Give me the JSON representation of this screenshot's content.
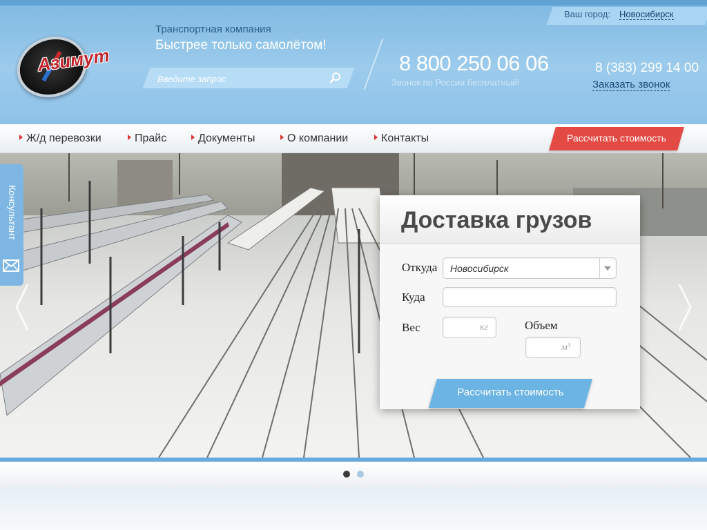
{
  "header": {
    "city_label": "Ваш город:",
    "city_value": "Новосибирск",
    "logo_text": "Азимут",
    "tagline_small": "Транспортная компания",
    "tagline_big": "Быстрее только самолётом!",
    "search_placeholder": "Введите запрос",
    "phone_main": "8 800 250 06 06",
    "phone_main_note": "Звонок по России бесплатный!",
    "phone_local": "8 (383) 299 14 00",
    "callback_label": "Заказать звонок"
  },
  "nav": {
    "items": [
      {
        "label": "Ж/д перевозки"
      },
      {
        "label": "Прайс"
      },
      {
        "label": "Документы"
      },
      {
        "label": "О компании"
      },
      {
        "label": "Контакты"
      }
    ],
    "calc_label": "Рассчитать стоимость"
  },
  "side": {
    "consult_label": "Консультант"
  },
  "form": {
    "title": "Доставка грузов",
    "from_label": "Откуда",
    "from_value": "Новосибирск",
    "to_label": "Куда",
    "to_value": "",
    "weight_label": "Вес",
    "weight_unit": "кг",
    "volume_label": "Объем",
    "volume_unit": "м³",
    "submit_label": "Рассчитать стоимость"
  },
  "slider": {
    "active_index": 0,
    "count": 2
  },
  "colors": {
    "accent_red": "#e34a44",
    "accent_blue": "#6cb4e4",
    "header_blue": "#8dc2e8"
  }
}
